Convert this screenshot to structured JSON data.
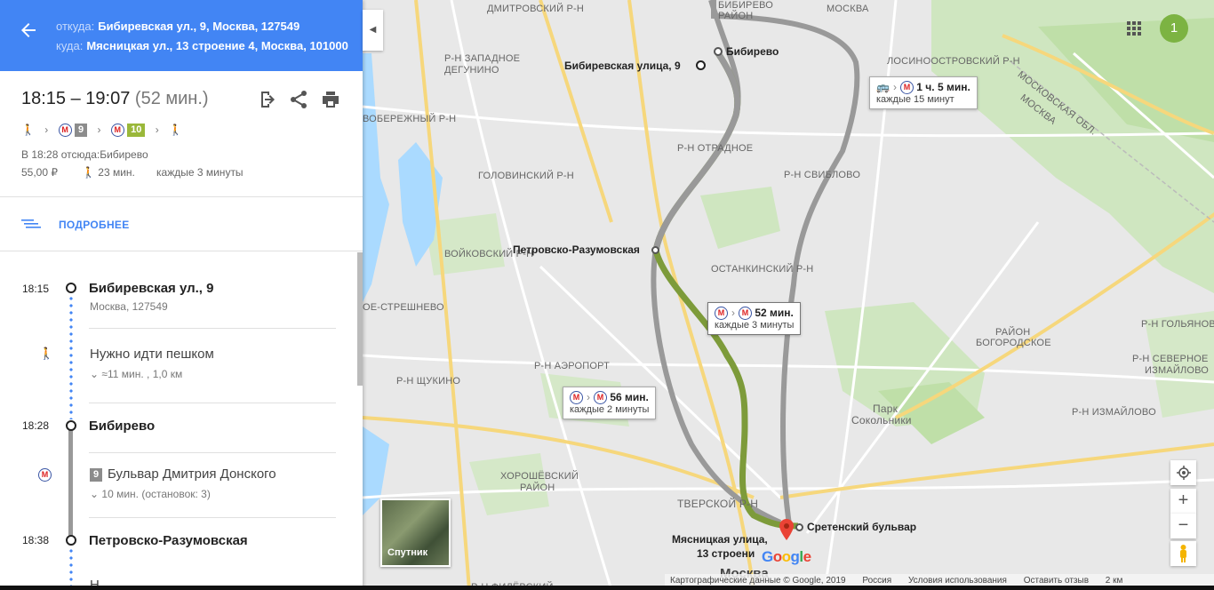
{
  "header": {
    "from_label": "откуда:",
    "from_value": "Бибиревская ул., 9, Москва, 127549",
    "to_label": "куда:",
    "to_value": "Мясницкая ул., 13 строение 4, Москва, 101000",
    "color": "#4285f4"
  },
  "summary": {
    "times": "18:15 – 19:07",
    "duration": "(52 мин.)",
    "line9": "9",
    "line10": "10",
    "line9_color": "#8c8c8c",
    "line10_color": "#9ab83a",
    "depart_info": "В 18:28 отсюда:Бибирево",
    "price": "55,00 ₽",
    "walk": "23 мин.",
    "frequency": "каждые 3 минуты"
  },
  "details_label": "ПОДРОБНЕЕ",
  "itinerary": {
    "s1_time": "18:15",
    "s1_name": "Бибиревская ул., 9",
    "s1_sub": "Москва, 127549",
    "walk_text": "Нужно идти пешком",
    "walk_sub": "≈11 мин. , 1,0 км",
    "s2_time": "18:28",
    "s2_name": "Бибирево",
    "ride_line": "9",
    "ride_text": "Бульвар Дмитрия Донского",
    "ride_sub": "10 мин. (остановок: 3)",
    "s3_time": "18:38",
    "s3_name": "Петровско-Разумовская",
    "s4_partial": "Н"
  },
  "map": {
    "labels": {
      "dmitrovsky": "ДМИТРОВСКИЙ Р-Н",
      "bibirevo_rayon": "БИБИРЕВО",
      "rayon_top": "РАЙОН",
      "moskva_small": "МОСКВА",
      "losinoostrov": "ЛОСИНООСТРОВСКИЙ Р-Н",
      "zapadnoe1": "Р-Н ЗАПАДНОЕ",
      "zapadnoe2": "ДЕГУНИНО",
      "moskobl": "МОСКОВСКАЯ ОБЛ.",
      "moskva_road": "МОСКВА",
      "beregov": "ВОБЕРЕЖНЫЙ Р-Н",
      "otradnoe": "Р-Н ОТРАДНОЕ",
      "golovinsky": "ГОЛОВИНСКИЙ Р-Н",
      "sviblovo": "Р-Н СВИБЛОВО",
      "voykovsky": "ВОЙКОВСКИЙ Р-Н",
      "ostankino": "ОСТАНКИНСКИЙ Р-Н",
      "streshnevo": "ОЕ-СТРЕШНЕВО",
      "golyanovo": "Р-Н ГОЛЬЯНОВО",
      "bogorod1": "РАЙОН",
      "bogorod2": "БОГОРОДСКОЕ",
      "aeroport": "Р-Н АЭРОПОРТ",
      "izmailovo_n1": "Р-Н СЕВЕРНОЕ",
      "izmailovo_n2": "ИЗМАЙЛОВО",
      "shchukino": "Р-Н ЩУКИНО",
      "park1": "Парк",
      "park2": "Сокольники",
      "izmailovo": "Р-Н ИЗМАЙЛОВО",
      "khoroshev1": "ХОРОШЁВСКИЙ",
      "khoroshev2": "РАЙОН",
      "tverskoy": "ТВЕРСКОЙ Р-Н",
      "fili": "Р-Н ФИЛЁВСКИЙ",
      "moskva_center": "Москва"
    },
    "stop_origin": "Бибиревская улица, 9",
    "stop_bibirevo": "Бибирево",
    "stop_petrovsko": "Петровско-Разумовская",
    "stop_sretensky": "Сретенский бульвар",
    "dest1": "Мясницкая улица,",
    "dest2": "13 строени",
    "card_bus_time": "1 ч. 5 мин.",
    "card_bus_freq": "каждые 15 минут",
    "card_main_time": "52 мин.",
    "card_main_freq": "каждые 3 минуты",
    "card_alt_time": "56 мин.",
    "card_alt_freq": "каждые 2 минуты",
    "satellite": "Спутник",
    "google": "Google",
    "avatar": "1",
    "footer": {
      "data": "Картографические данные © Google, 2019",
      "country": "Россия",
      "terms": "Условия использования",
      "feedback": "Оставить отзыв",
      "scale": "2 км"
    }
  }
}
